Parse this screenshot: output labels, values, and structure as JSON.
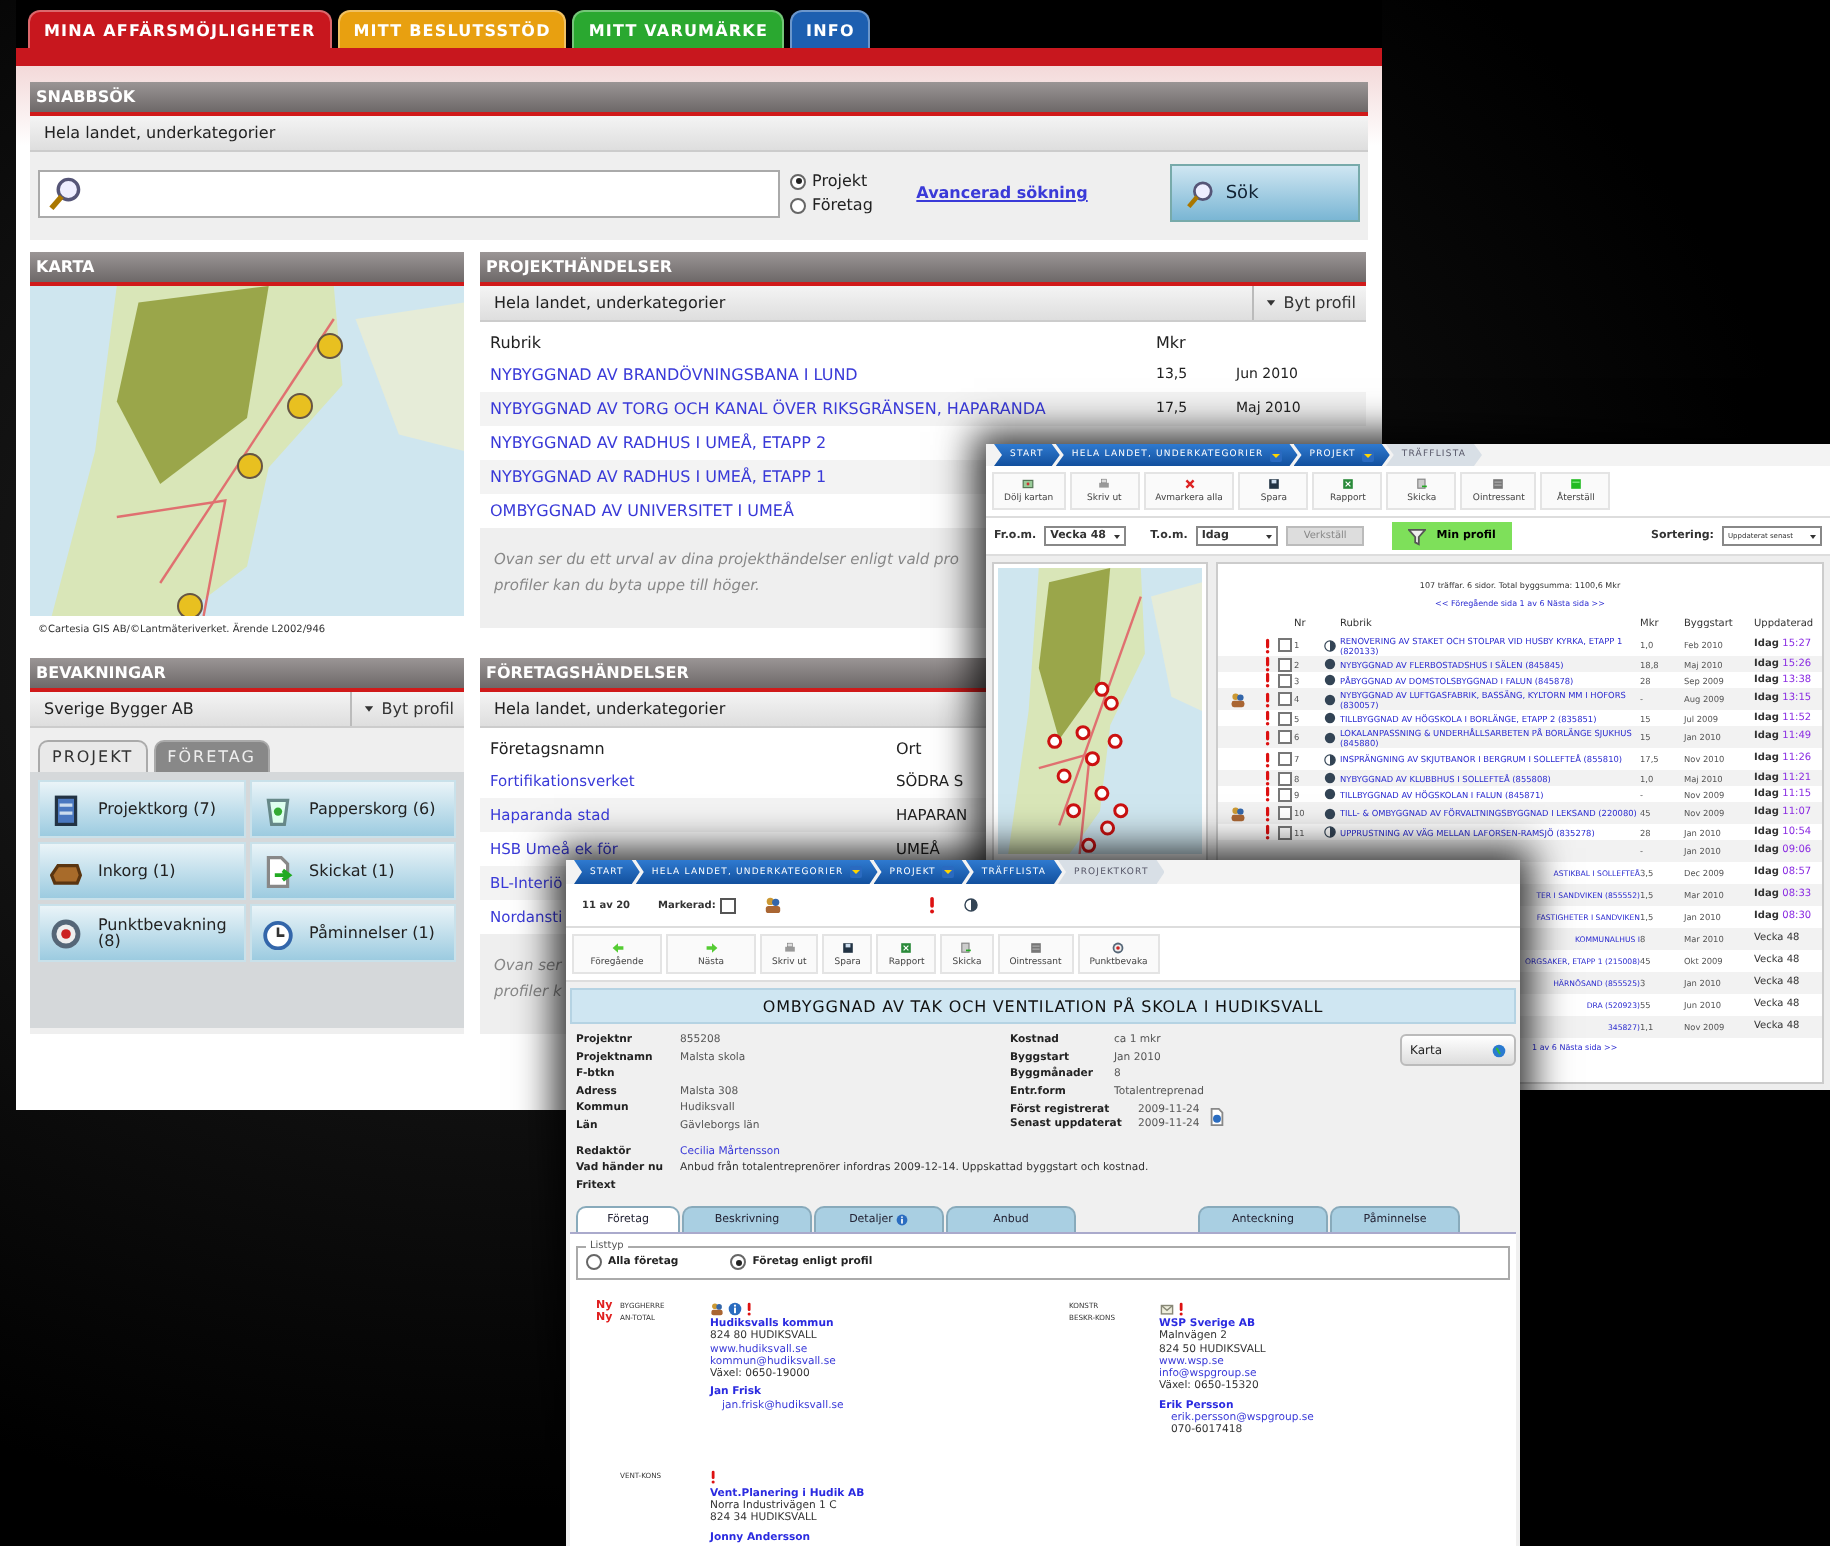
{
  "main": {
    "tabs": [
      {
        "label": "MINA AFFÄRSMÖJLIGHETER",
        "selected": true,
        "color": "#c8171e"
      },
      {
        "label": "MITT BESLUTSSTÖD",
        "selected": false,
        "color": "#e8a010"
      },
      {
        "label": "MITT VARUMÄRKE",
        "selected": false,
        "color": "#2aa830"
      },
      {
        "label": "INFO",
        "selected": false,
        "color": "#1d5fb0"
      }
    ],
    "quick_search": {
      "title": "SNABBSÖK",
      "scope": "Hela landet, underkategorier",
      "options": [
        {
          "label": "Projekt",
          "selected": true
        },
        {
          "label": "Företag",
          "selected": false
        }
      ],
      "advanced_link": "Avancerad sökning",
      "button": "Sök"
    },
    "map_panel": {
      "title": "KARTA",
      "credit": "©Cartesia GIS AB/©Lantmäteriverket. Ärende L2002/946"
    },
    "project_events": {
      "title": "PROJEKTHÄNDELSER",
      "scope": "Hela landet, underkategorier",
      "profile_button": "Byt profil",
      "columns": [
        "Rubrik",
        "Mkr"
      ],
      "rows": [
        {
          "title": "NYBYGGNAD AV BRANDÖVNINGSBANA I LUND",
          "mkr": "13,5",
          "date": "Jun 2010"
        },
        {
          "title": "NYBYGGNAD AV TORG OCH KANAL ÖVER RIKSGRÄNSEN, HAPARANDA",
          "mkr": "17,5",
          "date": "Maj 2010"
        },
        {
          "title": "NYBYGGNAD AV RADHUS I UMEÅ, ETAPP 2"
        },
        {
          "title": "NYBYGGNAD AV RADHUS I UMEÅ, ETAPP 1"
        },
        {
          "title": "OMBYGGNAD AV UNIVERSITET I UMEÅ"
        }
      ],
      "note_lines": [
        "Ovan ser du ett urval av dina projekthändelser enligt vald pro",
        "profiler kan du byta uppe till höger."
      ]
    },
    "watches": {
      "title": "BEVAKNINGAR",
      "profile": "Sverige Bygger AB",
      "profile_button": "Byt profil",
      "tabs": [
        {
          "label": "PROJEKT",
          "selected": true
        },
        {
          "label": "FÖRETAG",
          "selected": false
        }
      ],
      "tiles": [
        {
          "kind": "cabinet",
          "label": "Projektkorg (7)"
        },
        {
          "kind": "bin",
          "label": "Papperskorg (6)"
        },
        {
          "kind": "tray",
          "label": "Inkorg (1)"
        },
        {
          "kind": "sent",
          "label": "Skickat (1)"
        },
        {
          "kind": "target",
          "label": "Punktbevakning (8)"
        },
        {
          "kind": "clock",
          "label": "Påminnelser (1)"
        }
      ]
    },
    "company_events": {
      "title": "FÖRETAGSHÄNDELSER",
      "scope": "Hela landet, underkategorier",
      "columns": [
        "Företagsnamn",
        "Ort"
      ],
      "rows": [
        {
          "name": "Fortifikationsverket",
          "city": "SÖDRA S"
        },
        {
          "name": "Haparanda stad",
          "city": "HAPARAN"
        },
        {
          "name": "HSB Umeå ek för",
          "city": "UMEÅ"
        },
        {
          "name": "BL-Interiö"
        },
        {
          "name": "Nordansti"
        }
      ],
      "note_lines": [
        "Ovan ser",
        "profiler k"
      ]
    }
  },
  "hit_list": {
    "breadcrumb": [
      {
        "label": "START",
        "menu": false,
        "selected": false
      },
      {
        "label": "HELA LANDET, UNDERKATEGORIER",
        "menu": true,
        "selected": false
      },
      {
        "label": "PROJEKT",
        "menu": true,
        "selected": false
      },
      {
        "label": "TRÄFFLISTA",
        "menu": false,
        "selected": true
      }
    ],
    "toolbar": [
      {
        "kind": "map",
        "label": "Dölj kartan"
      },
      {
        "kind": "print",
        "label": "Skriv ut"
      },
      {
        "kind": "cross",
        "label": "Avmarkera alla"
      },
      {
        "kind": "save",
        "label": "Spara"
      },
      {
        "kind": "excel",
        "label": "Rapport"
      },
      {
        "kind": "send",
        "label": "Skicka"
      },
      {
        "kind": "grey",
        "label": "Ointressant"
      },
      {
        "kind": "green",
        "label": "Återställ"
      }
    ],
    "filter": {
      "from_label": "Fr.o.m.",
      "from": "Vecka 48",
      "to_label": "T.o.m.",
      "to": "Idag",
      "apply": "Verkställ",
      "profile_button": "Min profil",
      "sort_label": "Sortering:",
      "sort": "Uppdaterat senast"
    },
    "summary": "107 träffar. 6 sidor. Total byggsumma: 1100,6 Mkr",
    "pager": "<< Föregående sida  1 av 6  Nästa sida >>",
    "columns": [
      "Nr",
      "Rubrik",
      "Mkr",
      "Byggstart",
      "Uppdaterad"
    ],
    "rows": [
      {
        "nr": "1",
        "title": "RENOVERING AV STAKET OCH STOLPAR VID HUSBY KYRKA, ETAPP 1 (820133)",
        "mkr": "1,0",
        "start": "Feb 2010",
        "day": "Idag",
        "time": "15:27",
        "contact": false,
        "checked": false,
        "kind": "partial"
      },
      {
        "nr": "2",
        "title": "NYBYGGNAD AV FLERBOSTADSHUS I SÄLEN (845845)",
        "mkr": "18,8",
        "start": "Maj 2010",
        "day": "Idag",
        "time": "15:26",
        "contact": false,
        "checked": false,
        "kind": "full"
      },
      {
        "nr": "3",
        "title": "PÅBYGGNAD AV DOMSTOLSBYGGNAD I FALUN (845878)",
        "mkr": "28",
        "start": "Sep 2009",
        "day": "Idag",
        "time": "13:38",
        "contact": false,
        "checked": false,
        "kind": "full"
      },
      {
        "nr": "4",
        "title": "NYBYGGNAD AV LUFTGASFABRIK, BASSÄNG, KYLTORN MM I HOFORS (830057)",
        "mkr": "-",
        "start": "Aug 2009",
        "day": "Idag",
        "time": "13:15",
        "contact": true,
        "checked": false,
        "kind": "full"
      },
      {
        "nr": "5",
        "title": "TILLBYGGNAD AV HÖGSKOLA I BORLÄNGE, ETAPP 2 (835851)",
        "mkr": "15",
        "start": "Jul 2009",
        "day": "Idag",
        "time": "11:52",
        "contact": false,
        "checked": false,
        "kind": "full"
      },
      {
        "nr": "6",
        "title": "LOKALANPASSNING & UNDERHÅLLSARBETEN PÅ BORLÄNGE SJUKHUS (845880)",
        "mkr": "15",
        "start": "Jan 2010",
        "day": "Idag",
        "time": "11:49",
        "contact": false,
        "checked": false,
        "kind": "full"
      },
      {
        "nr": "7",
        "title": "INSPRÄNGNING AV SKJUTBANOR I BERGRUM I SOLLEFTEÅ (855810)",
        "mkr": "17,5",
        "start": "Nov 2010",
        "day": "Idag",
        "time": "11:26",
        "contact": false,
        "checked": false,
        "kind": "partial"
      },
      {
        "nr": "8",
        "title": "NYBYGGNAD AV KLUBBHUS I SOLLEFTEÅ (855808)",
        "mkr": "1,0",
        "start": "Maj 2010",
        "day": "Idag",
        "time": "11:21",
        "contact": false,
        "checked": false,
        "kind": "full"
      },
      {
        "nr": "9",
        "title": "TILLBYGGNAD AV HÖGSKOLAN I FALUN (845871)",
        "mkr": "-",
        "start": "Nov 2009",
        "day": "Idag",
        "time": "11:15",
        "contact": false,
        "checked": false,
        "kind": "full"
      },
      {
        "nr": "10",
        "title": "TILL- & OMBYGGNAD AV FÖRVALTNINGSBYGGNAD I LEKSAND (220080)",
        "mkr": "45",
        "start": "Nov 2009",
        "day": "Idag",
        "time": "11:07",
        "contact": true,
        "checked": false,
        "kind": "full"
      },
      {
        "nr": "11",
        "title": "UPPRUSTNING AV VÄG MELLAN LAFORSEN-RAMSJÖ (835278)",
        "mkr": "28",
        "start": "Jan 2010",
        "day": "Idag",
        "time": "10:54",
        "contact": false,
        "checked": false,
        "kind": "partial"
      }
    ],
    "partial_rows": [
      {
        "mkr": "-",
        "start": "Jan 2010",
        "day": "Idag",
        "time": "09:06"
      },
      {
        "title": "ASTIKBAL I SOLLEFTEÅ",
        "mkr": "3,5",
        "start": "Dec 2009",
        "day": "Idag",
        "time": "08:57"
      },
      {
        "title": "TER I SANDVIKEN (855552)",
        "mkr": "1,5",
        "start": "Mar 2010",
        "day": "Idag",
        "time": "08:33"
      },
      {
        "title": "FASTIGHETER I SANDVIKEN",
        "mkr": "1,5",
        "start": "Jan 2010",
        "day": "Idag",
        "time": "08:30"
      },
      {
        "title": "KOMMUNALHUS I",
        "mkr": "8",
        "start": "Mar 2010",
        "day": "Vecka 48"
      },
      {
        "title": "ORGSAKER, ETAPP 1 (215008)",
        "mkr": "45",
        "start": "Okt 2009",
        "day": "Vecka 48"
      },
      {
        "title": "HÄRNÖSAND (855525)",
        "mkr": "3",
        "start": "Jan 2010",
        "day": "Vecka 48"
      },
      {
        "title": "DRA (520923)",
        "mkr": "55",
        "start": "Jun 2010",
        "day": "Vecka 48"
      },
      {
        "title": "345827)",
        "mkr": "1,1",
        "start": "Nov 2009",
        "day": "Vecka 48"
      }
    ],
    "pager_fragment": "1 av 6  Nästa sida >>"
  },
  "project_card": {
    "breadcrumb": [
      {
        "label": "START",
        "menu": false,
        "selected": false
      },
      {
        "label": "HELA LANDET, UNDERKATEGORIER",
        "menu": true,
        "selected": false
      },
      {
        "label": "PROJEKT",
        "menu": true,
        "selected": false
      },
      {
        "label": "TRÄFFLISTA",
        "menu": false,
        "selected": false
      },
      {
        "label": "PROJEKTKORT",
        "menu": false,
        "selected": true
      }
    ],
    "position": "11 av 20",
    "marked_label": "Markerad:",
    "marked": false,
    "toolbar": [
      {
        "kind": "back",
        "label": "Föregående"
      },
      {
        "kind": "next",
        "label": "Nästa"
      },
      {
        "kind": "print",
        "label": "Skriv ut"
      },
      {
        "kind": "save",
        "label": "Spara"
      },
      {
        "kind": "excel",
        "label": "Rapport"
      },
      {
        "kind": "send",
        "label": "Skicka"
      },
      {
        "kind": "grey",
        "label": "Ointressant"
      },
      {
        "kind": "target",
        "label": "Punktbevaka"
      }
    ],
    "title": "OMBYGGNAD AV TAK OCH VENTILATION PÅ SKOLA I HUDIKSVALL",
    "left_fields": [
      {
        "label": "Projektnr",
        "value": "855208"
      },
      {
        "label": "Projektnamn",
        "value": "Malsta skola"
      },
      {
        "label": "F-btkn"
      },
      {
        "label": "Adress",
        "value": "Malsta 308"
      },
      {
        "label": "Kommun",
        "value": "Hudiksvall"
      },
      {
        "label": "Län",
        "value": "Gävleborgs län"
      }
    ],
    "right_fields": [
      {
        "label": "Kostnad",
        "value": "ca 1 mkr"
      },
      {
        "label": "Byggstart",
        "value": "Jan 2010"
      },
      {
        "label": "Byggmånader",
        "value": "8"
      },
      {
        "label": "Entr.form",
        "value": "Totalentreprenad"
      }
    ],
    "dates": [
      {
        "label": "Först registrerat",
        "value": "2009-11-24"
      },
      {
        "label": "Senast uppdaterat",
        "value": "2009-11-24"
      }
    ],
    "map_button": "Karta",
    "notes": [
      {
        "label": "Redaktör",
        "value": "Cecilia Mårtensson",
        "kind": "link"
      },
      {
        "label": "Vad händer nu",
        "value": "Anbud från totalentreprenörer infordras 2009-12-14. Uppskattad byggstart och kostnad.",
        "kind": "text"
      },
      {
        "label": "Fritext"
      }
    ],
    "tabs": [
      {
        "label": "Företag",
        "selected": true,
        "gap_before": false
      },
      {
        "label": "Beskrivning",
        "selected": false,
        "gap_before": false
      },
      {
        "label": "Detaljer",
        "selected": false,
        "gap_before": false,
        "info": true
      },
      {
        "label": "Anbud",
        "selected": false,
        "gap_before": false
      },
      {
        "label": "Anteckning",
        "selected": false,
        "gap_before": true
      },
      {
        "label": "Påminnelse",
        "selected": false,
        "gap_before": false
      }
    ],
    "list_type": {
      "legend": "Listtyp",
      "options": [
        {
          "label": "Alla företag",
          "selected": false
        },
        {
          "label": "Företag enligt profil",
          "selected": true
        }
      ]
    },
    "companies": [
      {
        "roles": [
          {
            "label": "BYGGHERRE",
            "new": "Ny"
          },
          {
            "label": "AN-TOTAL",
            "new": "Ny"
          }
        ],
        "icons": [
          {
            "kind": "people"
          },
          {
            "kind": "info"
          },
          {
            "kind": "alert"
          }
        ],
        "name": "Hudiksvalls kommun",
        "lines": [
          {
            "text": "824 80 HUDIKSVALL",
            "kind": "plain"
          },
          {
            "text": "www.hudiksvall.se",
            "kind": "link"
          },
          {
            "text": "kommun@hudiksvall.se",
            "kind": "link"
          },
          {
            "text": "Växel: 0650-19000",
            "kind": "plain"
          }
        ],
        "contact": {
          "name": "Jan Frisk",
          "lines": [
            {
              "text": "jan.frisk@hudiksvall.se",
              "kind": "link"
            }
          ]
        }
      },
      {
        "roles": [
          {
            "label": "KONSTR"
          },
          {
            "label": "BESKR-KONS"
          }
        ],
        "icons": [
          {
            "kind": "mail"
          },
          {
            "kind": "alert"
          }
        ],
        "name": "WSP Sverige AB",
        "lines": [
          {
            "text": "Malnvägen 2",
            "kind": "plain"
          },
          {
            "text": "824 50 HUDIKSVALL",
            "kind": "plain"
          },
          {
            "text": "www.wsp.se",
            "kind": "link"
          },
          {
            "text": "info@wspgroup.se",
            "kind": "link"
          },
          {
            "text": "Växel: 0650-15320",
            "kind": "plain"
          }
        ],
        "contact": {
          "name": "Erik Persson",
          "lines": [
            {
              "text": "erik.persson@wspgroup.se",
              "kind": "link"
            },
            {
              "text": "070-6017418",
              "kind": "plain"
            }
          ]
        }
      },
      {
        "roles": [
          {
            "label": "VENT-KONS"
          }
        ],
        "icons": [
          {
            "kind": "alert"
          }
        ],
        "name": "Vent.Planering i Hudik AB",
        "lines": [
          {
            "text": "Norra Industrivägen 1 C",
            "kind": "plain"
          },
          {
            "text": "824 34 HUDIKSVALL",
            "kind": "plain"
          }
        ],
        "contact": {
          "name": "Jonny Andersson"
        }
      }
    ]
  }
}
